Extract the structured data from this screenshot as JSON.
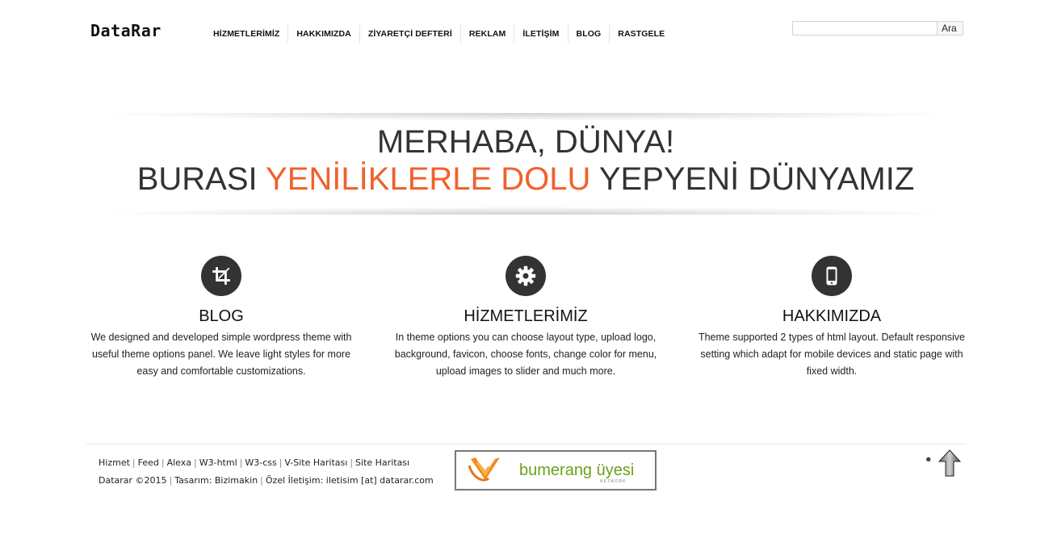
{
  "header": {
    "logo": "DataRar",
    "nav": [
      "HİZMETLERİMİZ",
      "HAKKIMIZDA",
      "ZİYARETÇİ DEFTERİ",
      "REKLAM",
      "İLETİŞİM",
      "BLOG",
      "RASTGELE"
    ],
    "search": {
      "value": "",
      "button": "Ara"
    }
  },
  "hero": {
    "line1": "MERHABA, DÜNYA!",
    "line2_a": "BURASI ",
    "line2_highlight": "YENİLİKLERLE DOLU",
    "line2_b": " YEPYENİ DÜNYAMIZ",
    "highlight_color": "#f2602c"
  },
  "features": [
    {
      "icon": "crop-icon",
      "title": "BLOG",
      "text": "We designed and developed simple wordpress theme with useful theme options panel. We leave light styles for more easy and comfortable customizations."
    },
    {
      "icon": "gear-icon",
      "title": "HİZMETLERİMİZ",
      "text": "In theme options you can choose layout type, upload logo, background, favicon, choose fonts, change color for menu, upload images to slider and much more."
    },
    {
      "icon": "mobile-icon",
      "title": "HAKKIMIZDA",
      "text": "Theme supported 2 types of html layout. Default responsive setting which adapt for mobile devices and static page with fixed width."
    }
  ],
  "footer": {
    "links": [
      "Hizmet",
      "Feed",
      "Alexa",
      "W3-html",
      "W3-css",
      "V-Site Haritası",
      "Site Haritası"
    ],
    "copyright": "Datarar ©2015",
    "design": "Tasarım: Bizimakin",
    "contact": "Özel İletişim: iletisim [at] datarar.com",
    "banner_text": "bumerang üyesi",
    "banner_sub": "NETWORK",
    "banner_color": "#6aa11a"
  }
}
